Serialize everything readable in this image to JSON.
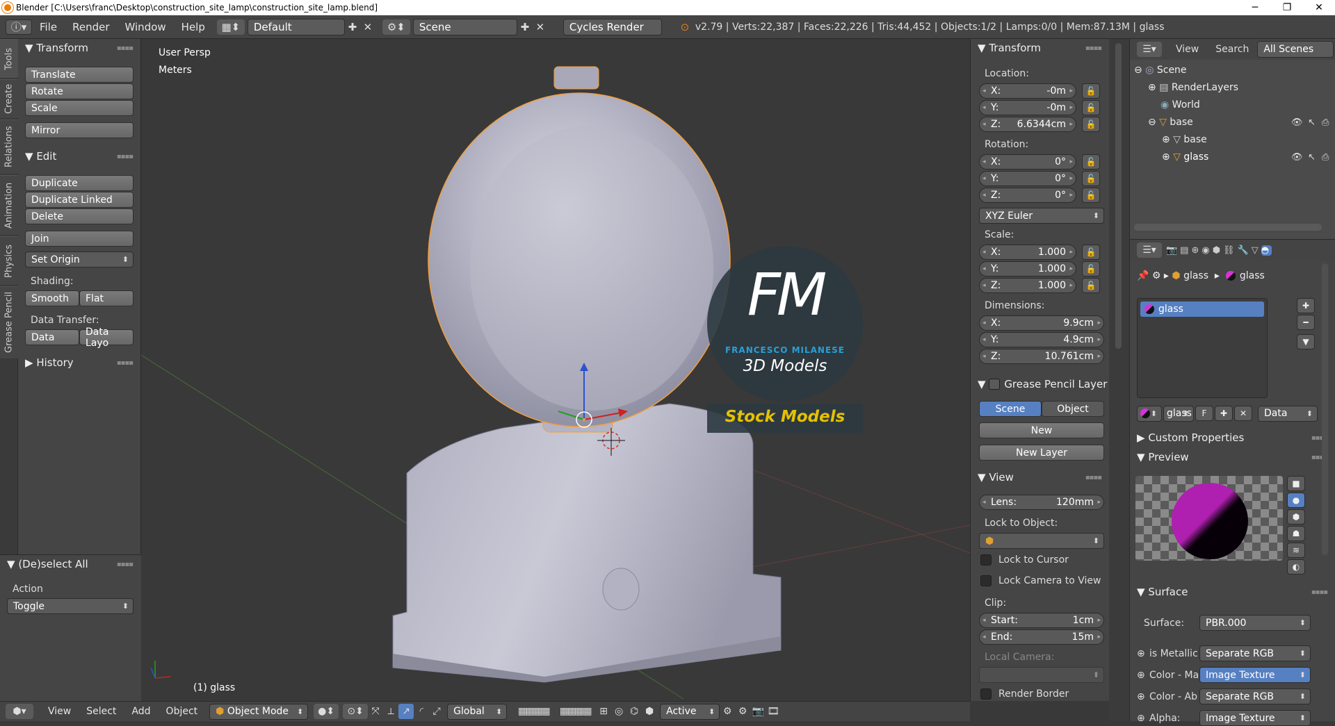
{
  "window": {
    "title": "Blender  [C:\\Users\\franc\\Desktop\\construction_site_lamp\\construction_site_lamp.blend]",
    "min": "─",
    "max": "❐",
    "close": "✕"
  },
  "topbar": {
    "menus": [
      "File",
      "Render",
      "Window",
      "Help"
    ],
    "layout": "Default",
    "scene": "Scene",
    "engine": "Cycles Render",
    "stats": "v2.79 | Verts:22,387 | Faces:22,226 | Tris:44,452 | Objects:1/2 | Lamps:0/0 | Mem:87.13M | glass"
  },
  "tabs": [
    "Tools",
    "Create",
    "Relations",
    "Animation",
    "Physics",
    "Grease Pencil"
  ],
  "toolshelf": {
    "transform_header": "Transform",
    "translate": "Translate",
    "rotate": "Rotate",
    "scale": "Scale",
    "mirror": "Mirror",
    "edit_header": "Edit",
    "duplicate": "Duplicate",
    "duplicate_linked": "Duplicate Linked",
    "delete": "Delete",
    "join": "Join",
    "set_origin": "Set Origin",
    "shading_label": "Shading:",
    "smooth": "Smooth",
    "flat": "Flat",
    "data_transfer_label": "Data Transfer:",
    "data": "Data",
    "data_layout": "Data Layo",
    "history_header": "History"
  },
  "lastop": {
    "header": "(De)select All",
    "action_label": "Action",
    "action_value": "Toggle"
  },
  "viewport": {
    "view_name": "User Persp",
    "units": "Meters",
    "object_label": "(1) glass",
    "watermark_letters": "FM",
    "watermark_name": "FRANCESCO MILANESE",
    "watermark_sub": "3D Models",
    "watermark_stock": "Stock Models"
  },
  "npanel": {
    "transform_header": "Transform",
    "location_label": "Location:",
    "loc": [
      {
        "axis": "X:",
        "value": "-0m"
      },
      {
        "axis": "Y:",
        "value": "-0m"
      },
      {
        "axis": "Z:",
        "value": "6.6344cm"
      }
    ],
    "rotation_label": "Rotation:",
    "rot": [
      {
        "axis": "X:",
        "value": "0°"
      },
      {
        "axis": "Y:",
        "value": "0°"
      },
      {
        "axis": "Z:",
        "value": "0°"
      }
    ],
    "rotation_mode": "XYZ Euler",
    "scale_label": "Scale:",
    "scale": [
      {
        "axis": "X:",
        "value": "1.000"
      },
      {
        "axis": "Y:",
        "value": "1.000"
      },
      {
        "axis": "Z:",
        "value": "1.000"
      }
    ],
    "dimensions_label": "Dimensions:",
    "dims": [
      {
        "axis": "X:",
        "value": "9.9cm"
      },
      {
        "axis": "Y:",
        "value": "4.9cm"
      },
      {
        "axis": "Z:",
        "value": "10.761cm"
      }
    ],
    "gp_header": "Grease Pencil Layer",
    "gp_scene": "Scene",
    "gp_object": "Object",
    "gp_new": "New",
    "gp_new_layer": "New Layer",
    "view_header": "View",
    "lens_label": "Lens:",
    "lens_value": "120mm",
    "lock_to_object": "Lock to Object:",
    "lock_to_cursor": "Lock to Cursor",
    "lock_camera": "Lock Camera to View",
    "clip_label": "Clip:",
    "clip_start_label": "Start:",
    "clip_start": "1cm",
    "clip_end_label": "End:",
    "clip_end": "15m",
    "local_camera": "Local Camera:",
    "render_border": "Render Border"
  },
  "outliner": {
    "view": "View",
    "search": "Search",
    "filter": "All Scenes",
    "items": [
      {
        "label": "Scene",
        "indent": 0
      },
      {
        "label": "RenderLayers",
        "indent": 1
      },
      {
        "label": "World",
        "indent": 1
      },
      {
        "label": "base",
        "indent": 1
      },
      {
        "label": "base",
        "indent": 2
      },
      {
        "label": "glass",
        "indent": 2
      }
    ]
  },
  "props": {
    "breadcrumb_obj": "glass",
    "breadcrumb_mat": "glass",
    "slot": "glass",
    "mat_name": "glass",
    "mat_f": "F",
    "mat_link": "Data",
    "custom_props": "Custom Properties",
    "preview": "Preview",
    "surface_header": "Surface",
    "surface_label": "Surface:",
    "surface_value": "PBR.000",
    "inputs": [
      {
        "label": "is Metallic",
        "value": "Separate RGB"
      },
      {
        "label": "Color - Ma",
        "value": "Image Texture"
      },
      {
        "label": "Color - Ab",
        "value": "Separate RGB"
      },
      {
        "label": "Alpha:",
        "value": "Image Texture"
      }
    ]
  },
  "bottombar": {
    "view": "View",
    "select": "Select",
    "add": "Add",
    "object": "Object",
    "mode": "Object Mode",
    "orientation": "Global",
    "pivot": "Active"
  },
  "colors": {
    "accent": "#5680c2",
    "selected_outline": "#f29e3c",
    "watermark_blue": "#2a9fd6",
    "stock_yellow": "#e5c100"
  }
}
